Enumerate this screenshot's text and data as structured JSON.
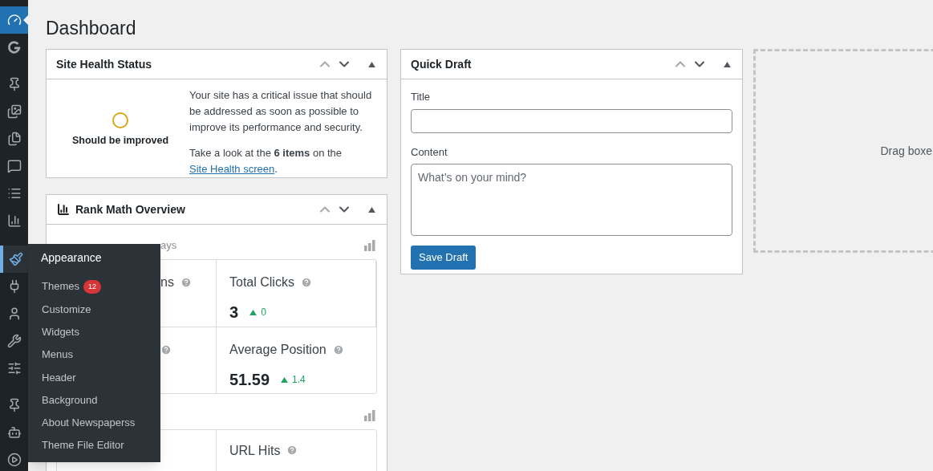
{
  "sidebar": {
    "items": [
      {
        "selected": true,
        "open": false
      },
      {
        "selected": false,
        "open": false
      },
      {
        "selected": false,
        "open": false
      },
      {
        "selected": false,
        "open": false
      },
      {
        "selected": false,
        "open": false
      },
      {
        "selected": false,
        "open": false
      },
      {
        "selected": false,
        "open": false
      },
      {
        "selected": false,
        "open": false
      },
      {
        "selected": false,
        "open": true
      },
      {
        "selected": false,
        "open": false
      },
      {
        "selected": false,
        "open": false
      },
      {
        "selected": false,
        "open": false
      },
      {
        "selected": false,
        "open": false
      },
      {
        "selected": false,
        "open": false
      },
      {
        "selected": false,
        "open": false
      },
      {
        "selected": false,
        "open": false
      }
    ]
  },
  "flyout": {
    "title": "Appearance",
    "items": [
      {
        "label": "Themes",
        "badge": "12"
      },
      {
        "label": "Customize"
      },
      {
        "label": "Widgets"
      },
      {
        "label": "Menus"
      },
      {
        "label": "Header"
      },
      {
        "label": "Background"
      },
      {
        "label": "About Newspaperss"
      },
      {
        "label": "Theme File Editor"
      }
    ]
  },
  "page_title": "Dashboard",
  "site_health": {
    "title": "Site Health Status",
    "status": "Should be improved",
    "message": "Your site has a critical issue that should be addressed as soon as possible to improve its performance and security.",
    "prompt": "Take a look at the **6 items** on the ",
    "link": "Site Health screen",
    "after_link": "."
  },
  "rank_math": {
    "title": "Rank Math Overview",
    "period_fragment": "ays",
    "stats": [
      {
        "label": "ns",
        "help": true
      },
      {
        "label": "Total Clicks",
        "value": "3",
        "change": "0",
        "help": true
      },
      {
        "help": true
      },
      {
        "label": "Average Position",
        "value": "51.59",
        "change": "1.4",
        "help": true
      }
    ],
    "stats2": [
      {
        "label": "URL Hits",
        "help": true
      }
    ]
  },
  "quick_draft": {
    "title": "Quick Draft",
    "title_label": "Title",
    "content_label": "Content",
    "content_placeholder": "What’s on your mind?",
    "button": "Save Draft"
  },
  "drop_zone": {
    "text": "Drag boxe"
  }
}
